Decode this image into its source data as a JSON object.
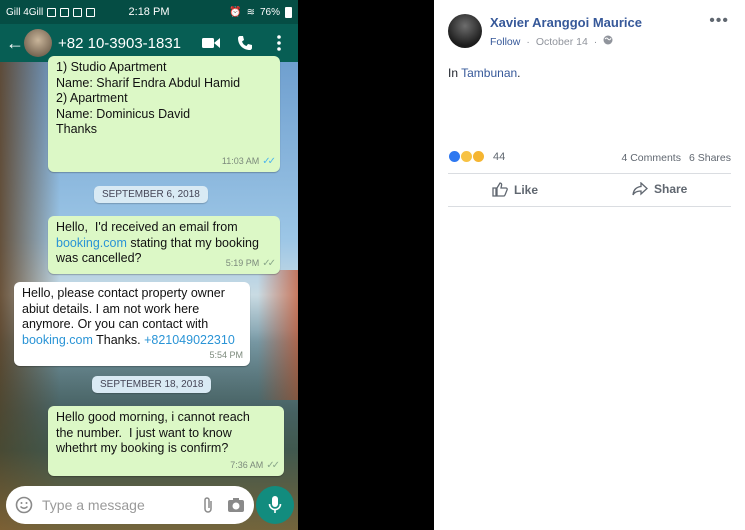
{
  "phone": {
    "status": {
      "network": "Gill 4Gill",
      "time": "2:18 PM",
      "battery": "76%"
    },
    "appbar": {
      "contact": "+82 10-3903-1831"
    },
    "messages": [
      {
        "lines": [
          "1) Studio Apartment",
          "Name: Sharif Endra Abdul Hamid",
          "",
          "2) Apartment",
          "Name: Dominicus David",
          "",
          "Thanks"
        ],
        "time": "11:03 AM"
      },
      {
        "date": "SEPTEMBER 6, 2018"
      },
      {
        "l1": "Hello,  I'd received an email from",
        "link": "booking.com",
        "l2b": " stating that my booking",
        "l3": "was cancelled?",
        "time": "5:19 PM"
      },
      {
        "l1": "Hello, please contact property owner",
        "l2": "abiut details. I am not work here",
        "l3": "anymore. Or you can contact with",
        "link": "booking.com",
        "mid": " Thanks. ",
        "phone": "+821049022310",
        "time": "5:54 PM"
      },
      {
        "date": "SEPTEMBER 18, 2018"
      },
      {
        "lines": [
          "Hello good morning, i cannot reach",
          "the number.  I just want to know",
          "whethrt my booking is confirm?"
        ],
        "time": "7:36 AM"
      }
    ],
    "composer": {
      "placeholder": "Type a message"
    }
  },
  "post": {
    "author": "Xavier Aranggoi Maurice",
    "follow": "Follow",
    "date": "October 14",
    "text_prefix": "In ",
    "place": "Tambunan",
    "text_suffix": ".",
    "reaction_count": "44",
    "comments": "4 Comments",
    "shares": "6 Shares",
    "like_label": "Like",
    "share_label": "Share",
    "more": "•••"
  }
}
